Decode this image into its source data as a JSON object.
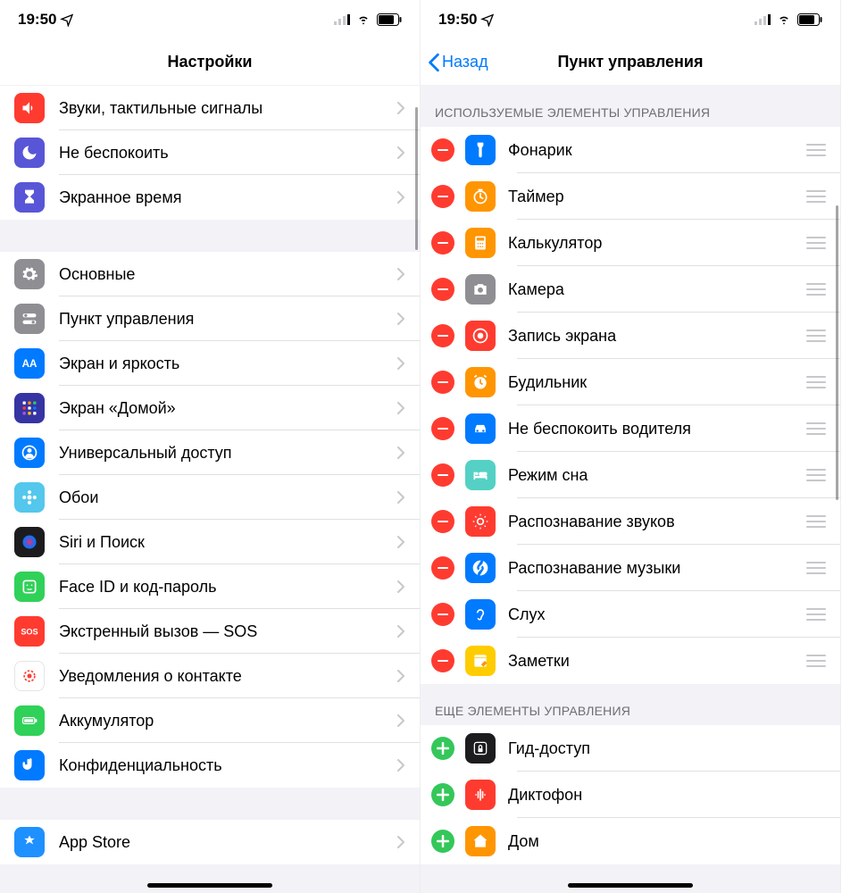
{
  "status": {
    "time": "19:50"
  },
  "left": {
    "title": "Настройки",
    "group1": [
      {
        "key": "sounds",
        "label": "Звуки, тактильные сигналы",
        "color": "#ff3b30",
        "icon": "speaker"
      },
      {
        "key": "dnd",
        "label": "Не беспокоить",
        "color": "#5856d6",
        "icon": "moon"
      },
      {
        "key": "screentime",
        "label": "Экранное время",
        "color": "#5856d6",
        "icon": "hourglass"
      }
    ],
    "group2": [
      {
        "key": "general",
        "label": "Основные",
        "color": "#8e8e93",
        "icon": "gear"
      },
      {
        "key": "controlcenter",
        "label": "Пункт управления",
        "color": "#8e8e93",
        "icon": "switches"
      },
      {
        "key": "display",
        "label": "Экран и яркость",
        "color": "#007aff",
        "icon": "aa"
      },
      {
        "key": "homescreen",
        "label": "Экран «Домой»",
        "color": "#3634a3",
        "icon": "grid"
      },
      {
        "key": "accessibility",
        "label": "Универсальный доступ",
        "color": "#007aff",
        "icon": "person"
      },
      {
        "key": "wallpaper",
        "label": "Обои",
        "color": "#54c7ec",
        "icon": "flower"
      },
      {
        "key": "siri",
        "label": "Siri и Поиск",
        "color": "#1c1c1e",
        "icon": "siri"
      },
      {
        "key": "faceid",
        "label": "Face ID и код-пароль",
        "color": "#30d158",
        "icon": "face"
      },
      {
        "key": "sos",
        "label": "Экстренный вызов — SOS",
        "color": "#ff3b30",
        "icon": "sos"
      },
      {
        "key": "exposure",
        "label": "Уведомления о контакте",
        "color": "#ffffff",
        "icon": "exposure"
      },
      {
        "key": "battery",
        "label": "Аккумулятор",
        "color": "#30d158",
        "icon": "battery"
      },
      {
        "key": "privacy",
        "label": "Конфиденциальность",
        "color": "#007aff",
        "icon": "hand"
      }
    ],
    "group3": [
      {
        "key": "appstore",
        "label": "App Store",
        "color": "#1e90ff",
        "icon": "appstore"
      }
    ]
  },
  "right": {
    "back": "Назад",
    "title": "Пункт управления",
    "section1": "ИСПОЛЬЗУЕМЫЕ ЭЛЕМЕНТЫ УПРАВЛЕНИЯ",
    "included": [
      {
        "key": "flashlight",
        "label": "Фонарик",
        "color": "#007aff",
        "icon": "flashlight"
      },
      {
        "key": "timer",
        "label": "Таймер",
        "color": "#ff9500",
        "icon": "timer"
      },
      {
        "key": "calculator",
        "label": "Калькулятор",
        "color": "#ff9500",
        "icon": "calculator"
      },
      {
        "key": "camera",
        "label": "Камера",
        "color": "#8e8e93",
        "icon": "camera"
      },
      {
        "key": "screenrecord",
        "label": "Запись экрана",
        "color": "#ff3b30",
        "icon": "record"
      },
      {
        "key": "alarm",
        "label": "Будильник",
        "color": "#ff9500",
        "icon": "alarm"
      },
      {
        "key": "dnddrive",
        "label": "Не беспокоить водителя",
        "color": "#007aff",
        "icon": "car"
      },
      {
        "key": "sleep",
        "label": "Режим сна",
        "color": "#54d1c4",
        "icon": "bed"
      },
      {
        "key": "soundrec",
        "label": "Распознавание звуков",
        "color": "#ff3b30",
        "icon": "sound"
      },
      {
        "key": "musicrec",
        "label": "Распознавание музыки",
        "color": "#007aff",
        "icon": "shazam"
      },
      {
        "key": "hearing",
        "label": "Слух",
        "color": "#007aff",
        "icon": "ear"
      },
      {
        "key": "notes",
        "label": "Заметки",
        "color": "#ffcc00",
        "icon": "notes"
      }
    ],
    "section2": "ЕЩЕ ЭЛЕМЕНТЫ УПРАВЛЕНИЯ",
    "more": [
      {
        "key": "guided",
        "label": "Гид-доступ",
        "color": "#1c1c1e",
        "icon": "lock"
      },
      {
        "key": "voicememo",
        "label": "Диктофон",
        "color": "#ff3b30",
        "icon": "wave"
      },
      {
        "key": "home",
        "label": "Дом",
        "color": "#ff9500",
        "icon": "home"
      }
    ]
  }
}
